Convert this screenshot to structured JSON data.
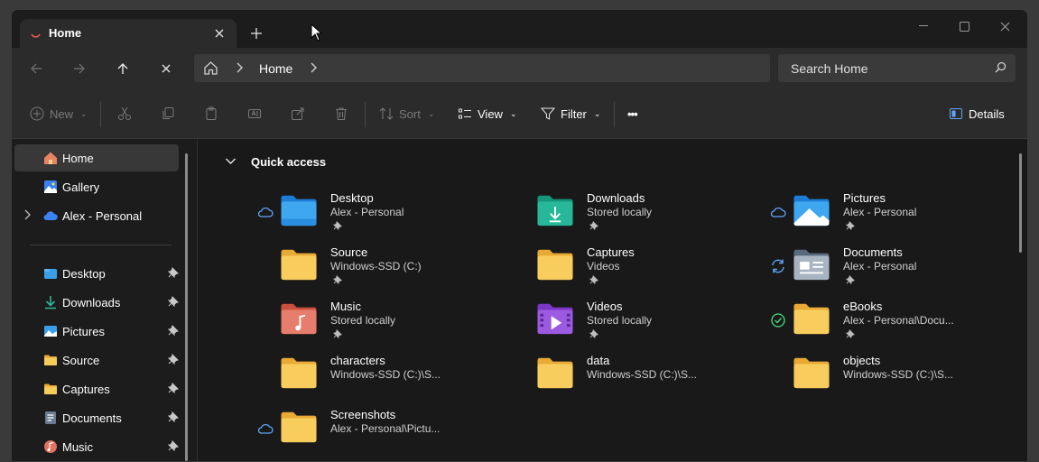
{
  "tab": {
    "title": "Home"
  },
  "address": {
    "location": "Home"
  },
  "search": {
    "placeholder": "Search Home"
  },
  "commands": {
    "new": "New",
    "sort": "Sort",
    "view": "View",
    "filter": "Filter",
    "more": "•••",
    "details": "Details"
  },
  "sidebar": {
    "top": [
      {
        "label": "Home",
        "icon": "home-icon"
      },
      {
        "label": "Gallery",
        "icon": "gallery-icon"
      },
      {
        "label": "Alex - Personal",
        "icon": "onedrive-icon"
      }
    ],
    "pinned": [
      {
        "label": "Desktop",
        "icon": "desktop-folder-icon"
      },
      {
        "label": "Downloads",
        "icon": "downloads-icon"
      },
      {
        "label": "Pictures",
        "icon": "pictures-icon"
      },
      {
        "label": "Source",
        "icon": "folder-icon"
      },
      {
        "label": "Captures",
        "icon": "folder-icon"
      },
      {
        "label": "Documents",
        "icon": "documents-icon"
      },
      {
        "label": "Music",
        "icon": "music-icon"
      }
    ]
  },
  "quick_access": {
    "title": "Quick access",
    "items": [
      {
        "name": "Desktop",
        "sub": "Alex - Personal",
        "status": "cloud",
        "icon": "desktop",
        "pinned": true
      },
      {
        "name": "Downloads",
        "sub": "Stored locally",
        "status": "",
        "icon": "downloads",
        "pinned": true
      },
      {
        "name": "Pictures",
        "sub": "Alex - Personal",
        "status": "cloud",
        "icon": "pictures",
        "pinned": true
      },
      {
        "name": "Source",
        "sub": "Windows-SSD (C:)",
        "status": "",
        "icon": "folder",
        "pinned": true
      },
      {
        "name": "Captures",
        "sub": "Videos",
        "status": "",
        "icon": "folder",
        "pinned": true
      },
      {
        "name": "Documents",
        "sub": "Alex - Personal",
        "status": "sync",
        "icon": "documents",
        "pinned": true
      },
      {
        "name": "Music",
        "sub": "Stored locally",
        "status": "",
        "icon": "music",
        "pinned": true
      },
      {
        "name": "Videos",
        "sub": "Stored locally",
        "status": "",
        "icon": "videos",
        "pinned": true
      },
      {
        "name": "eBooks",
        "sub": "Alex - Personal\\Docu...",
        "status": "check",
        "icon": "folder",
        "pinned": true
      },
      {
        "name": "characters",
        "sub": "Windows-SSD (C:)\\S...",
        "status": "",
        "icon": "folder",
        "pinned": false
      },
      {
        "name": "data",
        "sub": "Windows-SSD (C:)\\S...",
        "status": "",
        "icon": "folder",
        "pinned": false
      },
      {
        "name": "objects",
        "sub": "Windows-SSD (C:)\\S...",
        "status": "",
        "icon": "folder",
        "pinned": false
      },
      {
        "name": "Screenshots",
        "sub": "Alex - Personal\\Pictu...",
        "status": "cloud",
        "icon": "folder",
        "pinned": false
      }
    ]
  },
  "colors": {
    "accent": "#60a5fa",
    "folder": "#f5c84c",
    "window_bg": "#1c1c1c",
    "toolbar_bg": "#2b2b2b"
  }
}
